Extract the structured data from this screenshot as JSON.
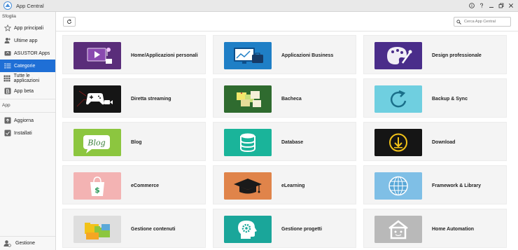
{
  "window": {
    "title": "App Central",
    "controls": [
      "info-icon",
      "help-icon",
      "minimize-icon",
      "restore-icon",
      "close-icon"
    ]
  },
  "sidebar": {
    "browse_heading": "Sfoglia",
    "items": [
      {
        "label": "App principali",
        "icon": "star-icon",
        "active": false
      },
      {
        "label": "Ultime app",
        "icon": "user-plus-icon",
        "active": false
      },
      {
        "label": "ASUSTOR Apps",
        "icon": "asustor-icon",
        "active": false
      },
      {
        "label": "Categorie",
        "icon": "list-icon",
        "active": true
      },
      {
        "label": "Tutte le applicazioni",
        "icon": "grid-icon",
        "active": false
      },
      {
        "label": "App beta",
        "icon": "beta-icon",
        "active": false
      }
    ],
    "app_heading": "App",
    "app_items": [
      {
        "label": "Aggiorna",
        "icon": "update-icon"
      },
      {
        "label": "Installati",
        "icon": "installed-icon"
      }
    ],
    "footer": {
      "label": "Gestione",
      "icon": "manage-icon"
    }
  },
  "toolbar": {
    "refresh_icon": "refresh-icon",
    "search_placeholder": "Cerca App Central"
  },
  "categories": [
    {
      "label": "Home/Applicazioni personali",
      "icon": "media-icon",
      "color": "#5a2d7a"
    },
    {
      "label": "Applicazioni Business",
      "icon": "business-icon",
      "color": "#1f7fc6"
    },
    {
      "label": "Design professionale",
      "icon": "palette-icon",
      "color": "#4a2d8a"
    },
    {
      "label": "Diretta streaming",
      "icon": "gamepad-icon",
      "color": "#151515"
    },
    {
      "label": "Bacheca",
      "icon": "board-icon",
      "color": "#2f6b2f"
    },
    {
      "label": "Backup & Sync",
      "icon": "sync-icon",
      "color": "#6fcfe0"
    },
    {
      "label": "Blog",
      "icon": "blog-icon",
      "color": "#8cc63f"
    },
    {
      "label": "Database",
      "icon": "database-icon",
      "color": "#1ab49a"
    },
    {
      "label": "Download",
      "icon": "download-icon",
      "color": "#151515"
    },
    {
      "label": "eCommerce",
      "icon": "shopping-bag-icon",
      "color": "#f3b3b3"
    },
    {
      "label": "eLearning",
      "icon": "graduation-cap-icon",
      "color": "#e0844a"
    },
    {
      "label": "Framework & Library",
      "icon": "globe-icon",
      "color": "#7fbfe6"
    },
    {
      "label": "Gestione contenuti",
      "icon": "folders-icon",
      "color": "#dedede"
    },
    {
      "label": "Gestione progetti",
      "icon": "gear-head-icon",
      "color": "#1aa69a"
    },
    {
      "label": "Home Automation",
      "icon": "smart-home-icon",
      "color": "#b9b9b9"
    }
  ]
}
